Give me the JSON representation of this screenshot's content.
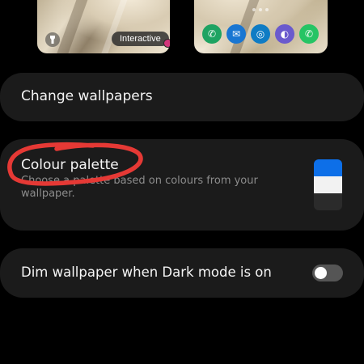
{
  "previews": {
    "lock_screen": {
      "interactive_label": "Interactive"
    },
    "home_screen": {
      "dock_icons": [
        {
          "name": "phone-icon",
          "glyph": "✆",
          "color": "#1ea362"
        },
        {
          "name": "messages-icon",
          "glyph": "✉",
          "color": "#1976d2"
        },
        {
          "name": "edge-browser-icon",
          "glyph": "◎",
          "color": "#0f7cc4"
        },
        {
          "name": "internet-icon",
          "glyph": "◐",
          "color": "#6a5acd"
        },
        {
          "name": "whatsapp-icon",
          "glyph": "✆",
          "color": "#25c464"
        }
      ]
    }
  },
  "settings": {
    "change_wallpapers": {
      "title": "Change wallpapers"
    },
    "colour_palette": {
      "title": "Colour palette",
      "subtitle": "Choose a palette based on colours from your wallpaper.",
      "swatch_colors": [
        "#0d6fe8",
        "#f2f2f2",
        "#2b2b2b"
      ]
    },
    "dim_wallpaper": {
      "title": "Dim wallpaper when Dark mode is on",
      "toggle_on": false
    }
  },
  "colors": {
    "background": "#000000",
    "card": "#1b1b1b",
    "annotation_circle": "#e53935",
    "accent_blue": "#0d6fe8"
  }
}
